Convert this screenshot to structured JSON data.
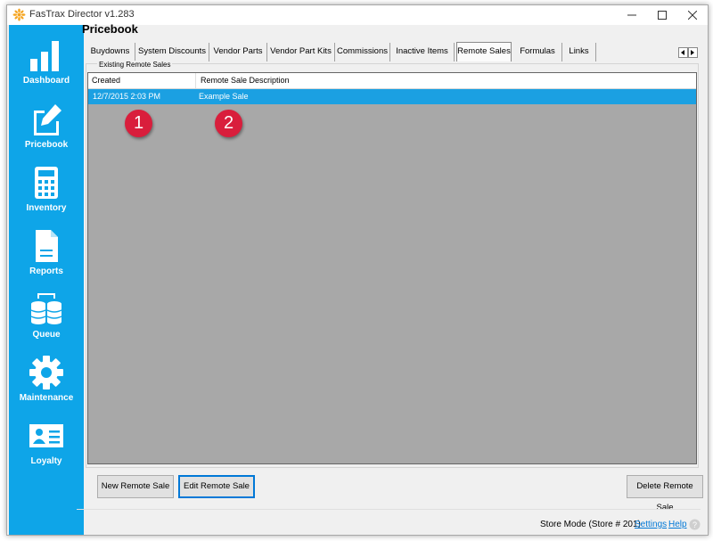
{
  "window": {
    "title": "FasTrax Director v1.283"
  },
  "sidebar": {
    "items": [
      {
        "label": "Dashboard",
        "icon": "bar-chart-icon"
      },
      {
        "label": "Pricebook",
        "icon": "edit-icon"
      },
      {
        "label": "Inventory",
        "icon": "calculator-icon"
      },
      {
        "label": "Reports",
        "icon": "document-icon"
      },
      {
        "label": "Queue",
        "icon": "database-icon"
      },
      {
        "label": "Maintenance",
        "icon": "gear-icon"
      },
      {
        "label": "Loyalty",
        "icon": "id-card-icon"
      }
    ]
  },
  "page": {
    "title": "Pricebook"
  },
  "tabs": [
    "Buydowns",
    "System Discounts",
    "Vendor Parts",
    "Vendor Part Kits",
    "Commissions",
    "Inactive Items",
    "Remote Sales",
    "Formulas",
    "Links"
  ],
  "active_tab": "Remote Sales",
  "group": {
    "label": "Existing Remote Sales"
  },
  "list": {
    "columns": [
      "Created",
      "Remote Sale Description"
    ],
    "rows": [
      {
        "created": "12/7/2015 2:03 PM",
        "description": "Example Sale",
        "selected": true
      }
    ]
  },
  "badges": [
    "1",
    "2"
  ],
  "buttons": {
    "new": "New Remote Sale",
    "edit": "Edit Remote Sale",
    "delete": "Delete Remote Sale"
  },
  "status": {
    "mode": "Store Mode (Store # 201)",
    "settings": "Settings",
    "help": "Help"
  },
  "colors": {
    "sidebar": "#0ea5e8",
    "selected_row": "#1ba0e2",
    "badge": "#d91e3c",
    "link": "#0078d7"
  }
}
